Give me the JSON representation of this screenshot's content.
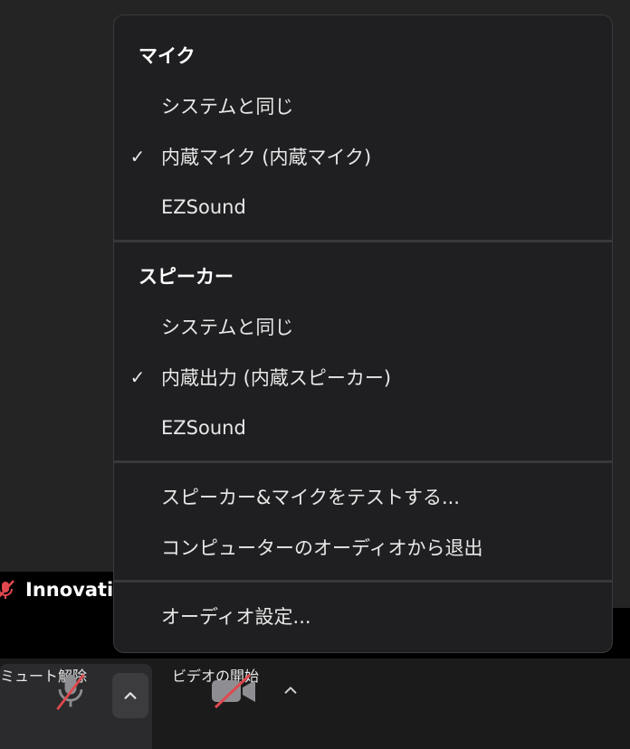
{
  "participant": {
    "name": "Innovatio"
  },
  "audio_menu": {
    "microphone_header": "マイク",
    "microphone_items": [
      {
        "label": "システムと同じ",
        "checked": false
      },
      {
        "label": "内蔵マイク (内蔵マイク)",
        "checked": true
      },
      {
        "label": "EZSound",
        "checked": false
      }
    ],
    "speaker_header": "スピーカー",
    "speaker_items": [
      {
        "label": "システムと同じ",
        "checked": false
      },
      {
        "label": "内蔵出力 (内蔵スピーカー)",
        "checked": true
      },
      {
        "label": "EZSound",
        "checked": false
      }
    ],
    "test_label": "スピーカー&マイクをテストする...",
    "leave_audio_label": "コンピューターのオーディオから退出",
    "audio_settings_label": "オーディオ設定...",
    "check_glyph": "✓"
  },
  "toolbar": {
    "unmute_label": "ミュート解除",
    "start_video_label": "ビデオの開始"
  },
  "colors": {
    "menu_bg": "#1f1f21",
    "muted_red": "#e0484e",
    "toolbar_bg": "#1b1b1c"
  },
  "icons": {
    "mic": "microphone-muted-icon",
    "video": "video-off-icon",
    "caret": "chevron-up-icon",
    "check": "checkmark-icon"
  }
}
